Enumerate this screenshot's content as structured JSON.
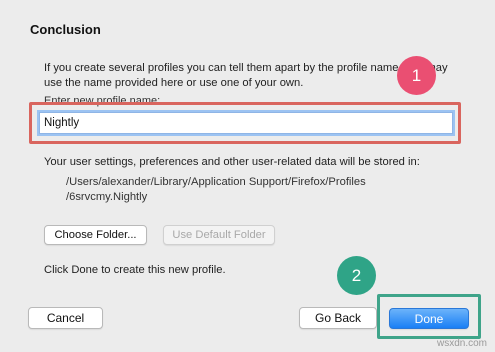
{
  "dialog": {
    "title": "Conclusion",
    "intro": "If you create several profiles you can tell them apart by the profile name. You may use the name provided here or use one of your own.",
    "field_label": "Enter new profile name:",
    "profile_name_value": "Nightly",
    "storage_text": "Your user settings, preferences and other user-related data will be stored in:",
    "path_line_1": "/Users/alexander/Library/Application Support/Firefox/Profiles",
    "path_line_2": "/6srvcmy.Nightly",
    "choose_folder_label": "Choose Folder...",
    "use_default_folder_label": "Use Default Folder",
    "done_hint": "Click Done to create this new profile.",
    "cancel_label": "Cancel",
    "go_back_label": "Go Back",
    "done_label": "Done"
  },
  "annotations": {
    "badge_1": "1",
    "badge_2": "2",
    "badge_1_color": "#ea4f72",
    "badge_2_color": "#2fa487",
    "highlight_1_color": "#d9655e",
    "highlight_2_color": "#3fa48a"
  },
  "watermark": "wsxdn.com"
}
